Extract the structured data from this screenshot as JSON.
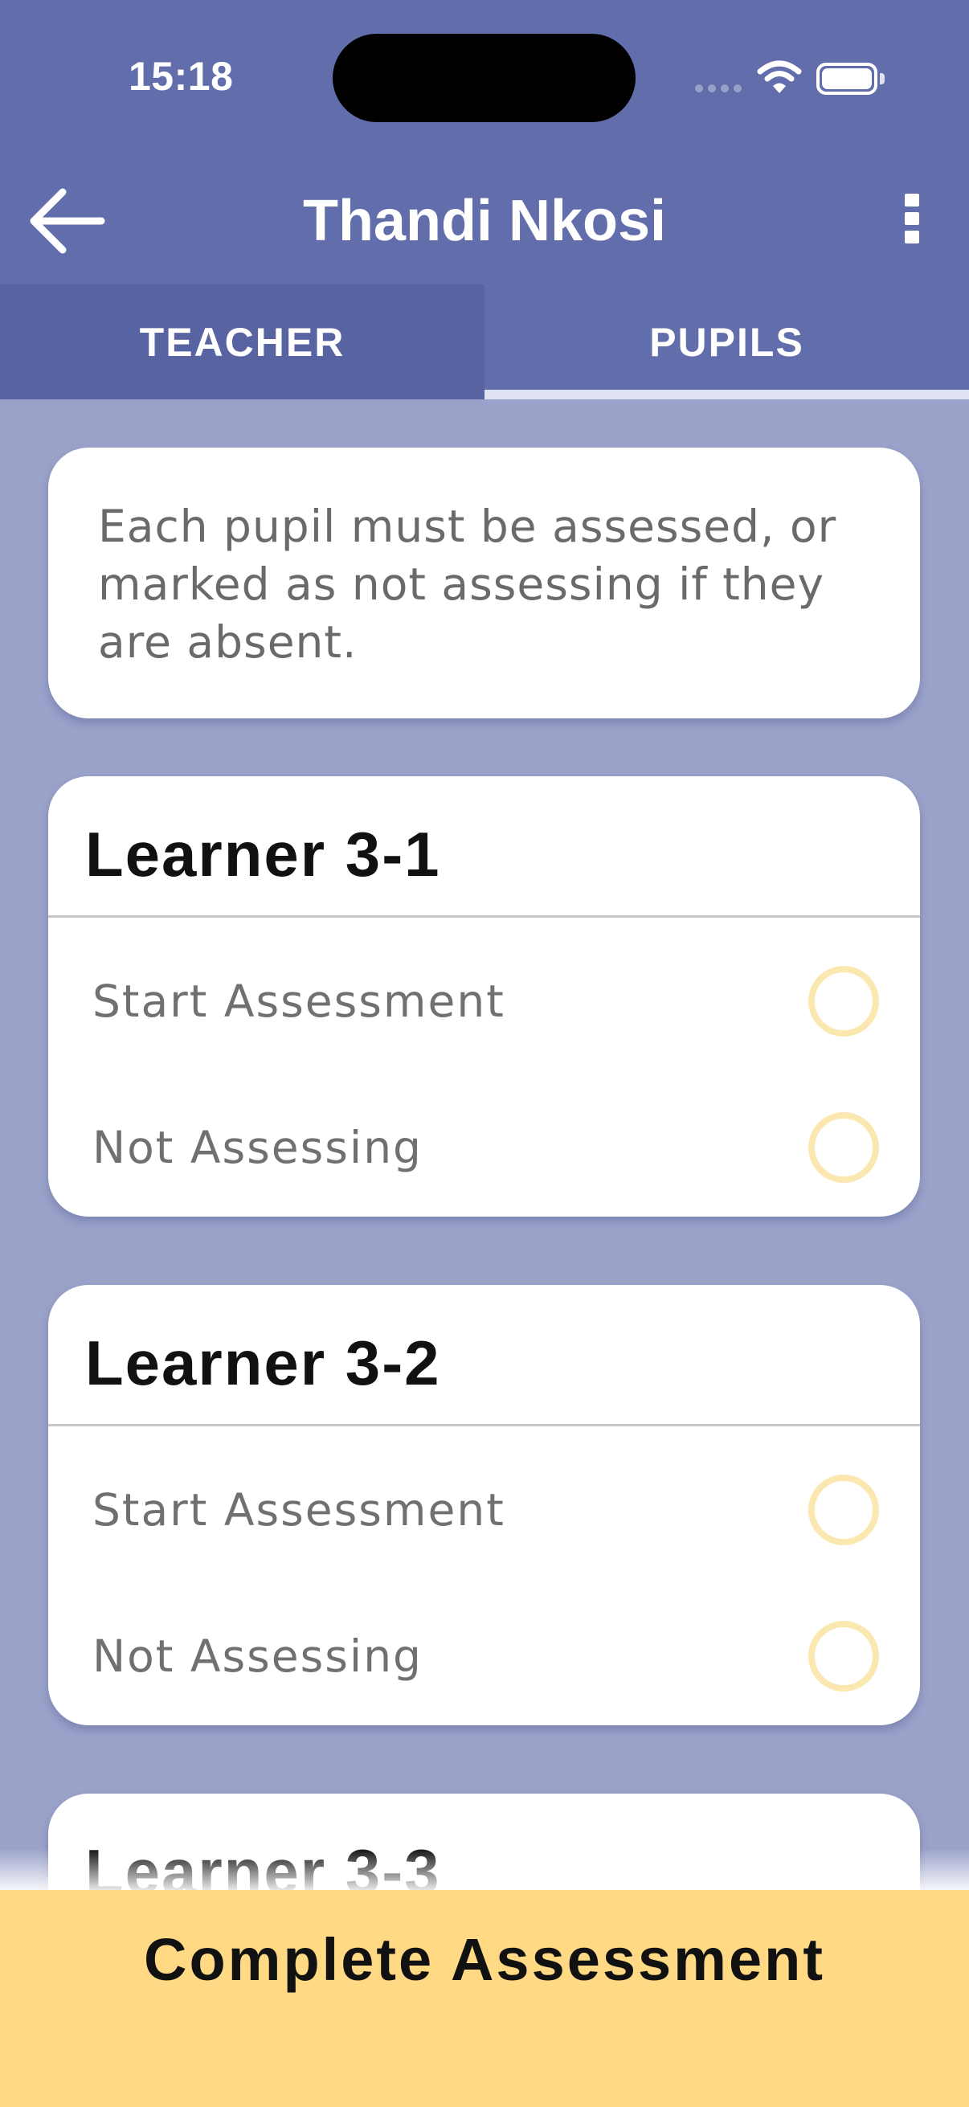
{
  "status_bar": {
    "time": "15:18",
    "icons": [
      "signal-icon",
      "wifi-icon",
      "battery-icon"
    ]
  },
  "nav": {
    "back_icon": "arrow-left-icon",
    "title": "Thandi Nkosi",
    "menu_icon": "more-vertical-icon"
  },
  "tabs": [
    {
      "label": "TEACHER",
      "selected": false
    },
    {
      "label": "PUPILS",
      "selected": true
    }
  ],
  "info": {
    "text": "Each pupil must be assessed, or marked as not assessing if they are absent."
  },
  "learners": [
    {
      "name": "Learner 3-1",
      "options": [
        "Start Assessment",
        "Not Assessing"
      ]
    },
    {
      "name": "Learner 3-2",
      "options": [
        "Start Assessment",
        "Not Assessing"
      ]
    },
    {
      "name": "Learner 3-3"
    }
  ],
  "footer": {
    "button_label": "Complete Assessment"
  },
  "colors": {
    "header": "#626dab",
    "background": "#9aa2ca",
    "accent": "#ffd983",
    "radio_border": "#fbe8b0"
  }
}
